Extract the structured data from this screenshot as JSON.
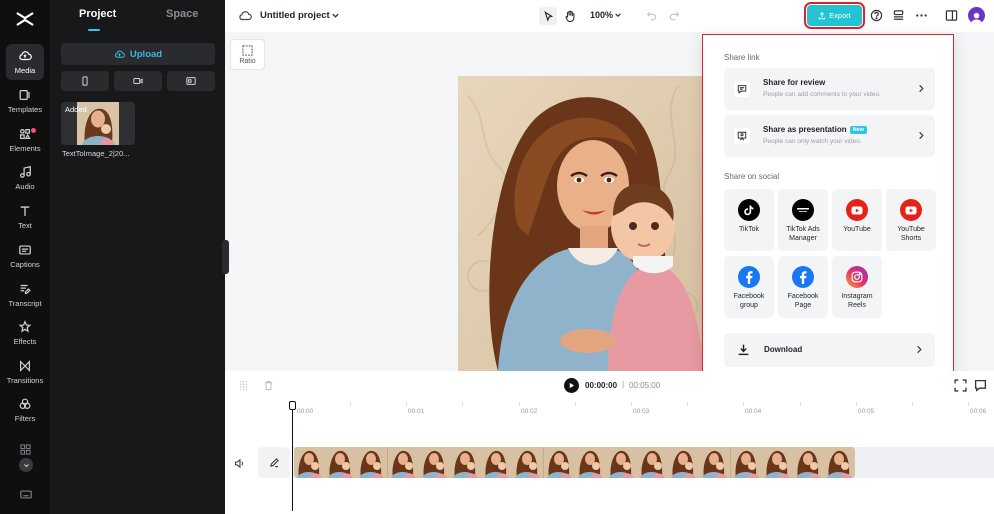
{
  "rail": {
    "items": [
      {
        "label": "Media",
        "icon": "media-icon"
      },
      {
        "label": "Templates",
        "icon": "templates-icon"
      },
      {
        "label": "Elements",
        "icon": "elements-icon"
      },
      {
        "label": "Audio",
        "icon": "audio-icon"
      },
      {
        "label": "Text",
        "icon": "text-icon"
      },
      {
        "label": "Captions",
        "icon": "captions-icon"
      },
      {
        "label": "Transcript",
        "icon": "transcript-icon"
      },
      {
        "label": "Effects",
        "icon": "effects-icon"
      },
      {
        "label": "Transitions",
        "icon": "transitions-icon"
      },
      {
        "label": "Filters",
        "icon": "filters-icon"
      }
    ]
  },
  "panel": {
    "tabs": [
      "Project",
      "Space"
    ],
    "upload_label": "Upload",
    "media_item": {
      "badge": "Added",
      "name": "TextToImage_2|20..."
    }
  },
  "topbar": {
    "project_title": "Untitled project",
    "zoom": "100%",
    "export_label": "Export"
  },
  "canvas": {
    "ratio_label": "Ratio"
  },
  "share": {
    "share_link_label": "Share link",
    "review": {
      "title": "Share for review",
      "desc": "People can add comments to your video."
    },
    "presentation": {
      "title": "Share as presentation",
      "badge": "New",
      "desc": "People can only watch your video."
    },
    "social_label": "Share on social",
    "social": [
      {
        "name": "TikTok",
        "icon": "tiktok-icon"
      },
      {
        "name": "TikTok Ads Manager",
        "icon": "tiktok-ads-icon"
      },
      {
        "name": "YouTube",
        "icon": "youtube-icon"
      },
      {
        "name": "YouTube Shorts",
        "icon": "youtube-shorts-icon"
      },
      {
        "name": "Facebook group",
        "icon": "facebook-icon"
      },
      {
        "name": "Facebook Page",
        "icon": "facebook-icon"
      },
      {
        "name": "Instagram Reels",
        "icon": "instagram-icon"
      }
    ],
    "download_label": "Download"
  },
  "timeline": {
    "current_time": "00:00:00",
    "separator": "|",
    "total_time": "00:05:00",
    "ruler": [
      "00:00",
      "00:01",
      "00:02",
      "00:03",
      "00:04",
      "00:05",
      "00:06"
    ]
  }
}
